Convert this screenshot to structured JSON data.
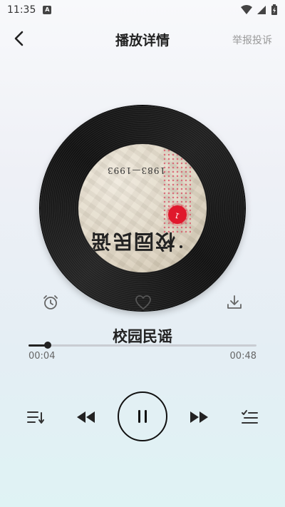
{
  "status": {
    "time": "11:35",
    "notification_glyph": "A"
  },
  "header": {
    "title": "播放详情",
    "report": "举报投诉"
  },
  "album": {
    "year_text": "1983—1993",
    "big_text": "校园民谣",
    "disc_number": "1"
  },
  "actions": {
    "alarm": "alarm-clock-icon",
    "favorite": "heart-icon",
    "download": "download-icon"
  },
  "track": {
    "title": "校园民谣",
    "current_time": "00:04",
    "total_time": "00:48",
    "progress": 0.0833
  },
  "colors": {
    "accent": "#111111",
    "track": "#c9ccd2",
    "disc_red": "#e0182c"
  }
}
